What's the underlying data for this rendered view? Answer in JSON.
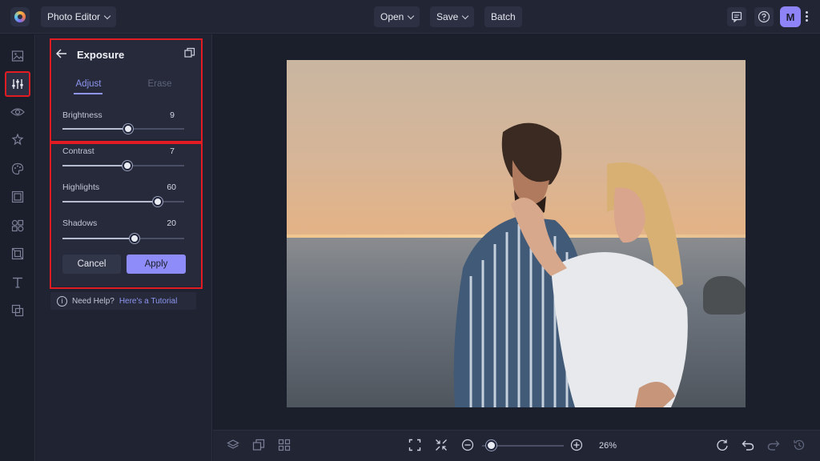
{
  "app": {
    "title": "Photo Editor",
    "menu": {
      "open_label": "Open",
      "save_label": "Save",
      "batch_label": "Batch"
    },
    "user_initial": "M"
  },
  "panel": {
    "title": "Exposure",
    "tabs": [
      {
        "label": "Adjust",
        "active": true
      },
      {
        "label": "Erase",
        "active": false
      }
    ],
    "sliders": [
      {
        "label": "Brightness",
        "value": "9",
        "fraction": 0.54
      },
      {
        "label": "Contrast",
        "value": "7",
        "fraction": 0.53
      },
      {
        "label": "Highlights",
        "value": "60",
        "fraction": 0.78
      },
      {
        "label": "Shadows",
        "value": "20",
        "fraction": 0.59
      }
    ],
    "cancel_label": "Cancel",
    "apply_label": "Apply",
    "help_text": "Need Help?",
    "help_link": "Here's a Tutorial"
  },
  "bottom": {
    "zoom_value": "26%",
    "zoom_fraction": 0.05
  },
  "colors": {
    "accent": "#8e8cf8",
    "highlight_border": "#e31b23",
    "background": "#1b1e2b"
  }
}
